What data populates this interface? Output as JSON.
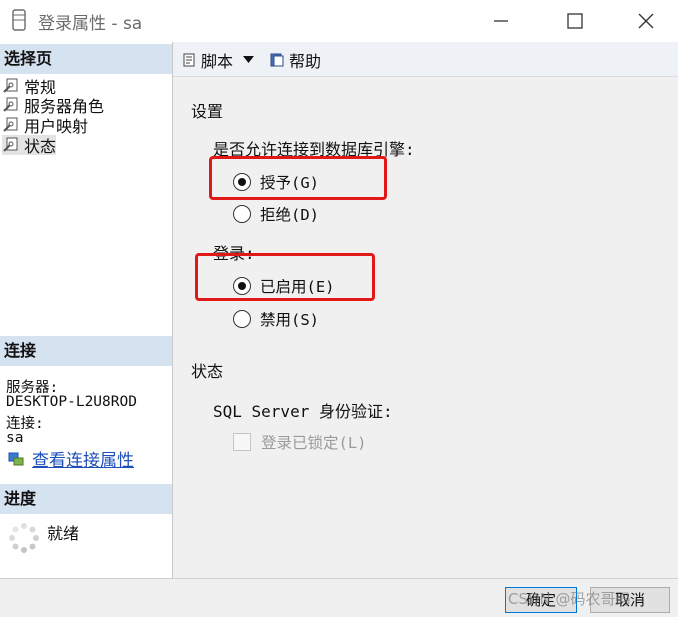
{
  "window": {
    "title": "登录属性 - sa"
  },
  "sidebar": {
    "pages_header": "选择页",
    "items": [
      {
        "label": "常规",
        "icon": "page-wrench-icon"
      },
      {
        "label": "服务器角色",
        "icon": "page-wrench-icon"
      },
      {
        "label": "用户映射",
        "icon": "page-wrench-icon"
      },
      {
        "label": "状态",
        "icon": "page-wrench-icon",
        "active": true
      }
    ],
    "connection_header": "连接",
    "server_label": "服务器:",
    "server_value": "DESKTOP-L2U8ROD",
    "connection_label": "连接:",
    "connection_value": "sa",
    "view_connection_link": "查看连接属性",
    "progress_header": "进度",
    "progress_status": "就绪"
  },
  "toolbar": {
    "script_label": "脚本",
    "help_label": "帮助"
  },
  "settings": {
    "heading": "设置",
    "permission_question": "是否允许连接到数据库引擎:",
    "grant_label": "授予(G)",
    "deny_label": "拒绝(D)",
    "login_label": "登录:",
    "enabled_label": "已启用(E)",
    "disabled_label": "禁用(S)",
    "grant_selected": true,
    "enabled_selected": true
  },
  "status": {
    "heading": "状态",
    "auth_label": "SQL Server 身份验证:",
    "locked_label": "登录已锁定(L)",
    "locked_checked": false
  },
  "buttons": {
    "ok": "确定",
    "cancel": "取消"
  },
  "watermark": "CSDN @码农哥码",
  "colors": {
    "highlight": "#e01818",
    "section_header": "#d5e2ef",
    "link": "#1d4fb8"
  }
}
